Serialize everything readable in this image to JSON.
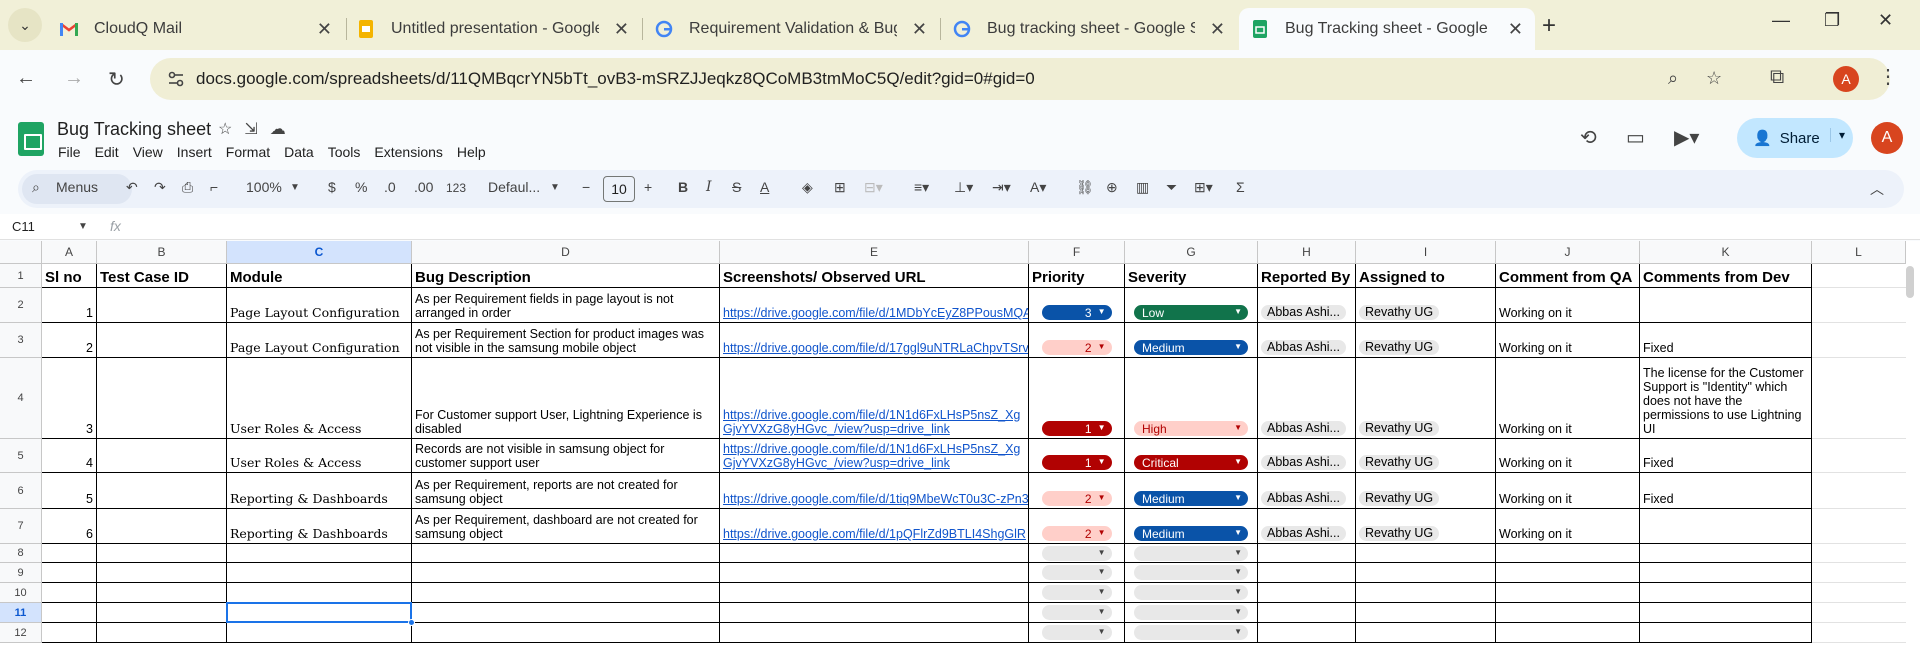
{
  "browser": {
    "tabs": [
      {
        "title": "CloudQ Mail",
        "icon": "gmail-icon"
      },
      {
        "title": "Untitled presentation - Google",
        "icon": "slides-icon"
      },
      {
        "title": "Requirement Validation & Bug",
        "icon": "google-icon"
      },
      {
        "title": "Bug tracking sheet - Google Se",
        "icon": "google-icon"
      },
      {
        "title": "Bug Tracking sheet - Google Sh",
        "icon": "sheets-icon"
      }
    ],
    "url": "docs.google.com/spreadsheets/d/11QMBqcrYN5bTt_ovB3-mSRZJJeqkz8QCoMB3tmMoC5Q/edit?gid=0#gid=0",
    "profile_initial": "A"
  },
  "sheets": {
    "title": "Bug Tracking sheet",
    "menu": [
      "File",
      "Edit",
      "View",
      "Insert",
      "Format",
      "Data",
      "Tools",
      "Extensions",
      "Help"
    ],
    "share_label": "Share",
    "avatar_initial": "A"
  },
  "format_toolbar": {
    "menus_label": "Menus",
    "zoom": "100%",
    "currency": "$",
    "percent": "%",
    "dec_decrease": ".0",
    "dec_increase": ".00",
    "number_format": "123",
    "font": "Defaul...",
    "font_size": "10"
  },
  "formula_bar": {
    "cell_ref": "C11",
    "fx": "fx"
  },
  "grid": {
    "columns": [
      "A",
      "B",
      "C",
      "D",
      "E",
      "F",
      "G",
      "H",
      "I",
      "J",
      "K",
      "L"
    ],
    "selected_column": "C",
    "selected_row": "11",
    "row_numbers": [
      "1",
      "2",
      "3",
      "4",
      "5",
      "6",
      "7",
      "8",
      "9",
      "10",
      "11",
      "12"
    ],
    "headers": [
      "Sl no",
      "Test Case ID",
      "Module",
      "Bug Description",
      "Screenshots/ Observed URL",
      "Priority",
      "Severity",
      "Reported By",
      "Assigned to",
      "Comment from QA",
      "Comments from Dev"
    ],
    "rows": [
      {
        "sl": "1",
        "module": "Page Layout Configuration",
        "desc": "As per Requirement fields in  page layout is not arranged in order",
        "url": "https://drive.google.com/file/d/1MDbYcEyZ8PPousMQA",
        "priority": "3",
        "severity": "Low",
        "reported": "Abbas Ashi...",
        "assigned": "Revathy UG",
        "qa": "Working on it",
        "dev": ""
      },
      {
        "sl": "2",
        "module": "Page Layout Configuration",
        "desc": "As per Requirement Section for product images was not visible in the samsung mobile object",
        "url": "https://drive.google.com/file/d/17ggl9uNTRLaChpvTSrv",
        "priority": "2",
        "severity": "Medium",
        "reported": "Abbas Ashi...",
        "assigned": "Revathy UG",
        "qa": "Working on it",
        "dev": "Fixed"
      },
      {
        "sl": "3",
        "module": "User Roles & Access",
        "desc": "For Customer support User, Lightning Experience is disabled",
        "url": "https://drive.google.com/file/d/1N1d6FxLHsP5nsZ_XgGjvYVXzG8yHGvc_/view?usp=drive_link",
        "priority": "1",
        "severity": "High",
        "reported": "Abbas Ashi...",
        "assigned": "Revathy UG",
        "qa": "Working on it",
        "dev": "The license for the Customer Support is \"Identity\" which does not have the permissions to use Lightning UI"
      },
      {
        "sl": "4",
        "module": "User Roles & Access",
        "desc": "Records are not visible in samsung object for customer support user",
        "url": "https://drive.google.com/file/d/1N1d6FxLHsP5nsZ_XgGjvYVXzG8yHGvc_/view?usp=drive_link",
        "priority": "1",
        "severity": "Critical",
        "reported": "Abbas Ashi...",
        "assigned": "Revathy UG",
        "qa": "Working on it",
        "dev": "Fixed"
      },
      {
        "sl": "5",
        "module": "Reporting & Dashboards",
        "desc": "As per Requirement, reports are not created for samsung object",
        "url": "https://drive.google.com/file/d/1tiq9MbeWcT0u3C-zPn3",
        "priority": "2",
        "severity": "Medium",
        "reported": "Abbas Ashi...",
        "assigned": "Revathy UG",
        "qa": "Working on it",
        "dev": "Fixed"
      },
      {
        "sl": "6",
        "module": "Reporting & Dashboards",
        "desc": "As per Requirement, dashboard are not created for samsung object",
        "url": "https://drive.google.com/file/d/1pQFlrZd9BTLI4ShgGlR",
        "priority": "2",
        "severity": "Medium",
        "reported": "Abbas Ashi...",
        "assigned": "Revathy UG",
        "qa": "Working on it",
        "dev": ""
      }
    ]
  },
  "colors": {
    "priority": {
      "1": "#b10202",
      "2": "#ffcfc9",
      "3": "#0a53a8"
    },
    "severity": {
      "Low": "#11734b",
      "Medium": "#0a53a8",
      "High": "#ffcfc9",
      "Critical": "#b10202"
    }
  }
}
